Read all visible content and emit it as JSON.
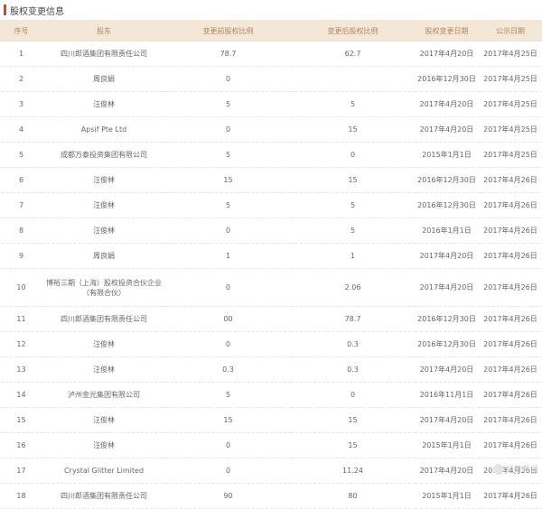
{
  "header": {
    "title": "股权变更信息"
  },
  "columns": [
    "序号",
    "股东",
    "变更前股权比例",
    "变更后股权比例",
    "股权变更日期",
    "公示日期"
  ],
  "rows": [
    [
      "1",
      "四川郎酒集团有限责任公司",
      "78.7",
      "62.7",
      "2017年4月20日",
      "2017年4月25日"
    ],
    [
      "2",
      "周良娟",
      "0",
      "",
      "2016年12月30日",
      "2017年4月25日"
    ],
    [
      "3",
      "汪俊林",
      "5",
      "5",
      "2017年4月20日",
      "2017年4月25日"
    ],
    [
      "4",
      "Apsif Pte Ltd",
      "0",
      "15",
      "2017年4月20日",
      "2017年4月25日"
    ],
    [
      "5",
      "成都万泰投资集团有限公司",
      "5",
      "0",
      "2015年1月1日",
      "2017年4月25日"
    ],
    [
      "6",
      "汪俊林",
      "15",
      "15",
      "2016年12月30日",
      "2017年4月26日"
    ],
    [
      "7",
      "汪俊林",
      "5",
      "5",
      "2016年12月30日",
      "2017年4月26日"
    ],
    [
      "8",
      "汪俊林",
      "0",
      "5",
      "2016年1月1日",
      "2017年4月26日"
    ],
    [
      "9",
      "周良娟",
      "1",
      "1",
      "2017年4月20日",
      "2017年4月26日"
    ],
    [
      "10",
      "博裕三期（上海）股权投资合伙企业（有限合伙）",
      "0",
      "2.06",
      "2017年4月20日",
      "2017年4月26日"
    ],
    [
      "11",
      "四川郎酒集团有限责任公司",
      "00",
      "78.7",
      "2016年12月30日",
      "2017年4月26日"
    ],
    [
      "12",
      "汪俊林",
      "0",
      "0.3",
      "2016年12月30日",
      "2017年4月26日"
    ],
    [
      "13",
      "汪俊林",
      "0.3",
      "0.3",
      "2017年4月20日",
      "2017年4月26日"
    ],
    [
      "14",
      "泸州金光集团有限公司",
      "5",
      "0",
      "2016年11月1日",
      "2017年4月26日"
    ],
    [
      "15",
      "汪俊林",
      "15",
      "15",
      "2017年4月20日",
      "2017年4月26日"
    ],
    [
      "16",
      "汪俊林",
      "0",
      "15",
      "2015年1月1日",
      "2017年4月26日"
    ],
    [
      "17",
      "Crystal Glitter Limited",
      "0",
      "11.24",
      "2017年4月20日",
      "2017年4月26日"
    ],
    [
      "18",
      "四川郎酒集团有限责任公司",
      "90",
      "80",
      "2015年1月1日",
      "2017年4月26日"
    ]
  ],
  "watermark": "经济新闻"
}
